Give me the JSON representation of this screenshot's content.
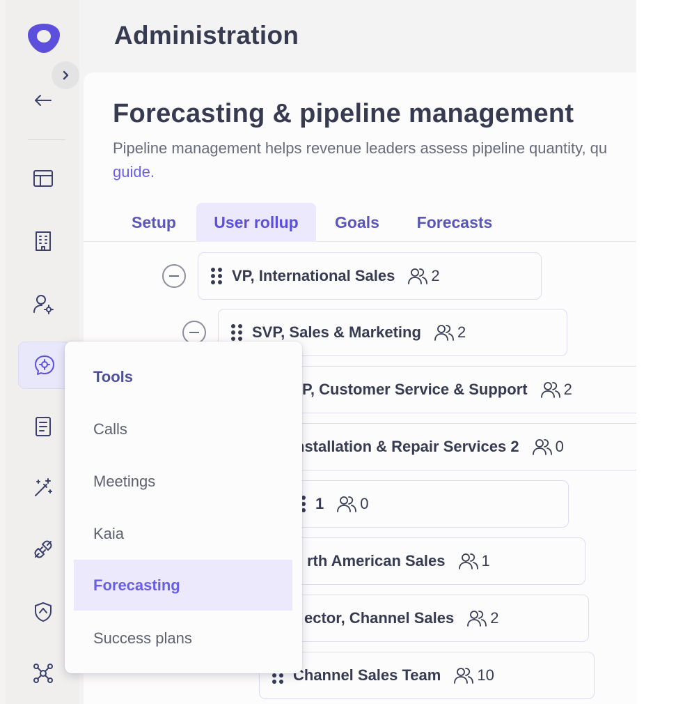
{
  "header": {
    "title": "Administration"
  },
  "card": {
    "title": "Forecasting & pipeline management",
    "description": "Pipeline management helps revenue leaders assess pipeline quantity, qu",
    "link": "guide."
  },
  "tabs": [
    {
      "label": "Setup"
    },
    {
      "label": "User rollup"
    },
    {
      "label": "Goals"
    },
    {
      "label": "Forecasts"
    }
  ],
  "tree": [
    {
      "label": "VP, International Sales",
      "count": "2"
    },
    {
      "label": "SVP, Sales & Marketing",
      "count": "2"
    },
    {
      "label": "P, Customer Service & Support",
      "count": "2"
    },
    {
      "label": "nstallation & Repair Services 2",
      "count": "0"
    },
    {
      "label": "1",
      "count": "0"
    },
    {
      "label": "rth American Sales",
      "count": "1"
    },
    {
      "label": "ector, Channel Sales",
      "count": "2"
    },
    {
      "label": "Channel Sales Team",
      "count": "10"
    }
  ],
  "menu": {
    "header": "Tools",
    "items": [
      "Calls",
      "Meetings",
      "Kaia",
      "Forecasting",
      "Success plans"
    ]
  },
  "rail_icons": [
    "layout-icon",
    "building-icon",
    "user-settings-icon",
    "settings-chat-icon",
    "document-icon",
    "magic-wand-icon",
    "plug-icon",
    "shield-icon",
    "network-icon"
  ],
  "colors": {
    "accent": "#5b4fdc",
    "text": "#363b52",
    "active_bg": "#ebe9fb"
  }
}
